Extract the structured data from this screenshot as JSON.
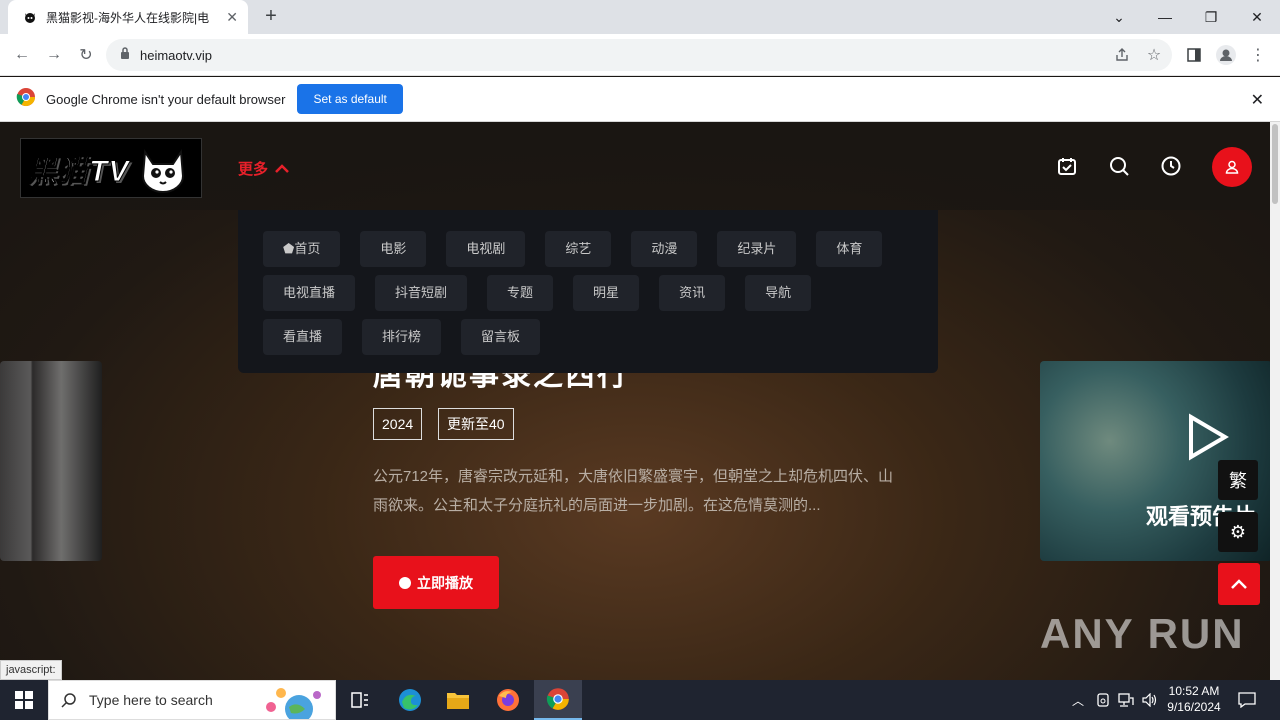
{
  "browser": {
    "tab_title": "黑猫影视-海外华人在线影院|电",
    "url": "heimaotv.vip",
    "infobar_message": "Google Chrome isn't your default browser",
    "infobar_button": "Set as default"
  },
  "site": {
    "logo_text": "黑猫TV",
    "more_label": "更多",
    "menu_rows": [
      [
        "首页",
        "电影",
        "电视剧",
        "综艺",
        "动漫",
        "纪录片",
        "体育"
      ],
      [
        "电视直播",
        "抖音短剧",
        "专题",
        "明星",
        "资讯",
        "导航"
      ],
      [
        "看直播",
        "排行榜",
        "留言板"
      ]
    ],
    "home_icon": "home-icon"
  },
  "hero": {
    "title": "唐朝诡事录之西行",
    "year": "2024",
    "update": "更新至40",
    "description": "公元712年，唐睿宗改元延和，大唐依旧繁盛寰宇，但朝堂之上却危机四伏、山雨欲来。公主和太子分庭抗礼的局面进一步加剧。在这危情莫测的...",
    "play_label": "立即播放",
    "trailer_label": "观看预告片",
    "traditional_label": "繁"
  },
  "status_text": "javascript:",
  "watermark": "ANY RUN",
  "taskbar": {
    "search_placeholder": "Type here to search",
    "time": "10:52 AM",
    "date": "9/16/2024"
  },
  "colors": {
    "accent": "#e8111b",
    "chrome_blue": "#1a73e8"
  }
}
